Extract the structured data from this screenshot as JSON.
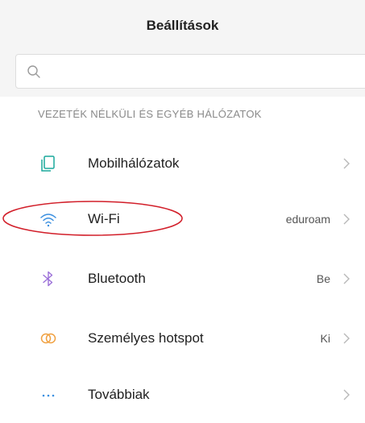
{
  "header": {
    "title": "Beállítások"
  },
  "search": {
    "placeholder": "",
    "value": ""
  },
  "section": {
    "title": "VEZETÉK NÉLKÜLI ÉS EGYÉB HÁLÓZATOK"
  },
  "rows": [
    {
      "label": "Mobilhálózatok",
      "value": "",
      "icon": "sim-cards-icon",
      "icon_color": "#1aa89c"
    },
    {
      "label": "Wi-Fi",
      "value": "eduroam",
      "icon": "wifi-icon",
      "icon_color": "#3a8fe0"
    },
    {
      "label": "Bluetooth",
      "value": "Be",
      "icon": "bluetooth-icon",
      "icon_color": "#9b6fd8"
    },
    {
      "label": "Személyes hotspot",
      "value": "Ki",
      "icon": "hotspot-icon",
      "icon_color": "#f0a040"
    },
    {
      "label": "Továbbiak",
      "value": "",
      "icon": "more-dots-icon",
      "icon_color": "#3a8fe0"
    }
  ],
  "annotation": {
    "color": "#d21f2a"
  }
}
